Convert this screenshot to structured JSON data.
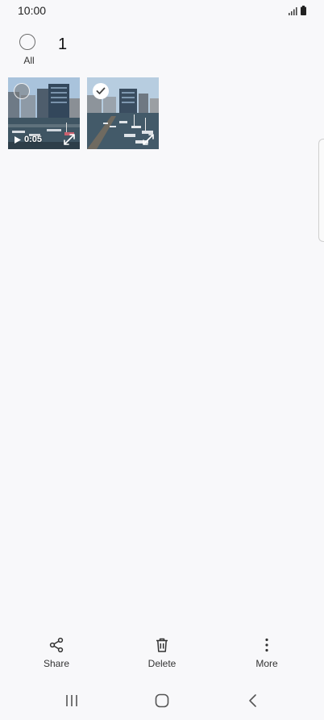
{
  "status": {
    "time": "10:00"
  },
  "header": {
    "all_label": "All",
    "selected_count": "1"
  },
  "items": [
    {
      "type": "video",
      "duration": "0:05",
      "selected": false
    },
    {
      "type": "image",
      "selected": true
    }
  ],
  "toolbar": {
    "share_label": "Share",
    "delete_label": "Delete",
    "more_label": "More"
  },
  "colors": {
    "background": "#f8f8fa",
    "icon": "#333333"
  }
}
